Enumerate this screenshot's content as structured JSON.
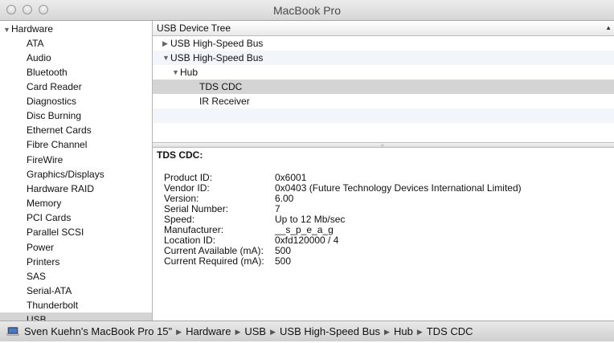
{
  "window": {
    "title": "MacBook Pro"
  },
  "sidebar": {
    "root": "Hardware",
    "items": [
      "ATA",
      "Audio",
      "Bluetooth",
      "Card Reader",
      "Diagnostics",
      "Disc Burning",
      "Ethernet Cards",
      "Fibre Channel",
      "FireWire",
      "Graphics/Displays",
      "Hardware RAID",
      "Memory",
      "PCI Cards",
      "Parallel SCSI",
      "Power",
      "Printers",
      "SAS",
      "Serial-ATA",
      "Thunderbolt",
      "USB"
    ],
    "selected": "USB"
  },
  "tree": {
    "header": "USB Device Tree",
    "rows": [
      {
        "label": "USB High-Speed Bus",
        "level": 0,
        "expander": "collapsed"
      },
      {
        "label": "USB High-Speed Bus",
        "level": 0,
        "expander": "expanded"
      },
      {
        "label": "Hub",
        "level": 1,
        "expander": "expanded"
      },
      {
        "label": "TDS CDC",
        "level": 2,
        "expander": "none",
        "selected": true
      },
      {
        "label": "IR Receiver",
        "level": 2,
        "expander": "none"
      }
    ]
  },
  "detail": {
    "title": "TDS CDC:",
    "properties": [
      {
        "key": "Product ID:",
        "value": "0x6001"
      },
      {
        "key": "Vendor ID:",
        "value": "0x0403  (Future Technology Devices International Limited)"
      },
      {
        "key": "Version:",
        "value": "6.00"
      },
      {
        "key": "Serial Number:",
        "value": "7"
      },
      {
        "key": "Speed:",
        "value": "Up to 12 Mb/sec"
      },
      {
        "key": "Manufacturer:",
        "value": "__s_p_e_a_g"
      },
      {
        "key": "Location ID:",
        "value": "0xfd120000 / 4"
      },
      {
        "key": "Current Available (mA):",
        "value": "500"
      },
      {
        "key": "Current Required (mA):",
        "value": "500"
      }
    ]
  },
  "pathbar": {
    "icon": "laptop-icon",
    "crumbs": [
      "Sven Kuehn's MacBook Pro 15\"",
      "Hardware",
      "USB",
      "USB High-Speed Bus",
      "Hub",
      "TDS CDC"
    ]
  }
}
